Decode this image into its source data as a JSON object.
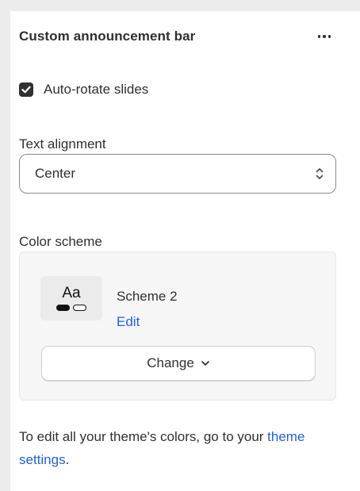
{
  "section": {
    "title": "Custom announcement bar",
    "more_icon": "more-horizontal-icon"
  },
  "auto_rotate": {
    "label": "Auto-rotate slides",
    "checked": true,
    "icon": "checkmark-icon"
  },
  "text_alignment": {
    "label": "Text alignment",
    "value": "Center",
    "icon": "select-chevrons-icon"
  },
  "color_scheme": {
    "label": "Color scheme",
    "preview_text": "Aa",
    "name": "Scheme 2",
    "edit_label": "Edit",
    "change_label": "Change",
    "change_icon": "chevron-down-icon"
  },
  "help": {
    "text_before": "To edit all your theme's colors, go to your ",
    "link": "theme settings",
    "text_after": "."
  },
  "colors": {
    "link": "#2463d0",
    "text": "#303030",
    "checkbox": "#303030"
  }
}
